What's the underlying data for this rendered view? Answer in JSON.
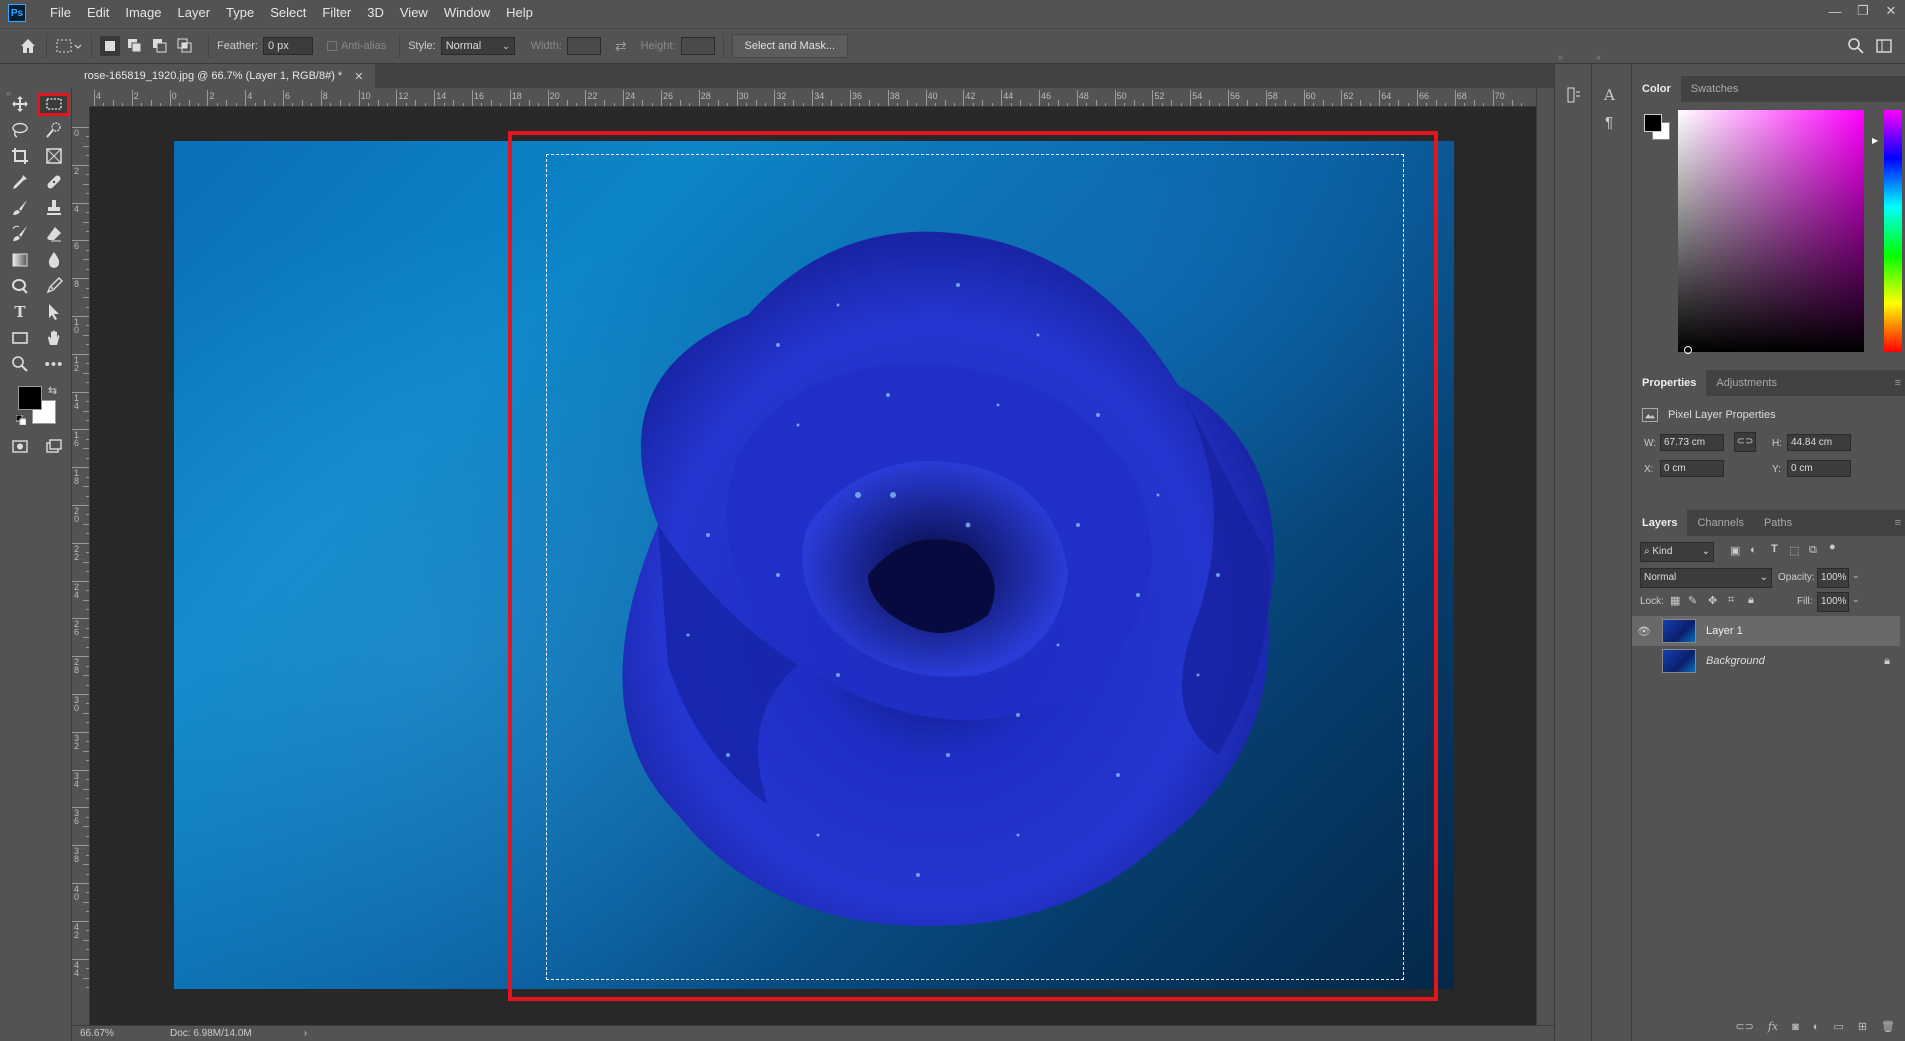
{
  "app": {
    "logo": "Ps"
  },
  "menu": [
    "File",
    "Edit",
    "Image",
    "Layer",
    "Type",
    "Select",
    "Filter",
    "3D",
    "View",
    "Window",
    "Help"
  ],
  "window_controls": {
    "minimize": "—",
    "restore": "❐",
    "close": "✕"
  },
  "options": {
    "feather_label": "Feather:",
    "feather_value": "0 px",
    "antialias_label": "Anti-alias",
    "style_label": "Style:",
    "style_value": "Normal",
    "width_label": "Width:",
    "height_label": "Height:",
    "select_mask_label": "Select and Mask..."
  },
  "document": {
    "tab_title": "rose-165819_1920.jpg @ 66.7% (Layer 1, RGB/8#) *",
    "zoom": "66.67%",
    "doc_size": "Doc: 6.98M/14.0M"
  },
  "ruler_h": [
    "4",
    "2",
    "0",
    "2",
    "4",
    "6",
    "8",
    "10",
    "12",
    "14",
    "16",
    "18",
    "20",
    "22",
    "24",
    "26",
    "28",
    "30",
    "32",
    "34",
    "36",
    "38",
    "40",
    "42",
    "44",
    "46",
    "48",
    "50",
    "52",
    "54",
    "56",
    "58",
    "60",
    "62",
    "64",
    "66",
    "68",
    "70"
  ],
  "ruler_v": [
    "0",
    "2",
    "4",
    "6",
    "8",
    "10",
    "12",
    "14",
    "16",
    "18",
    "20",
    "22",
    "24",
    "26",
    "28",
    "30",
    "32",
    "34",
    "36",
    "38",
    "40",
    "42",
    "44"
  ],
  "color_panel": {
    "tab_color": "Color",
    "tab_swatches": "Swatches"
  },
  "properties_panel": {
    "tab_properties": "Properties",
    "tab_adjustments": "Adjustments",
    "header": "Pixel Layer Properties",
    "w_label": "W:",
    "w_value": "67.73 cm",
    "h_label": "H:",
    "h_value": "44.84 cm",
    "x_label": "X:",
    "x_value": "0 cm",
    "y_label": "Y:",
    "y_value": "0 cm"
  },
  "layers_panel": {
    "tab_layers": "Layers",
    "tab_channels": "Channels",
    "tab_paths": "Paths",
    "filter_kind": "Kind",
    "blend_mode": "Normal",
    "opacity_label": "Opacity:",
    "opacity_value": "100%",
    "lock_label": "Lock:",
    "fill_label": "Fill:",
    "fill_value": "100%",
    "layers": [
      {
        "name": "Layer 1",
        "visible": true,
        "selected": true
      },
      {
        "name": "Background",
        "visible": false,
        "locked": true
      }
    ]
  },
  "colors": {
    "highlight": "#e3151f",
    "bg": "#535353"
  }
}
